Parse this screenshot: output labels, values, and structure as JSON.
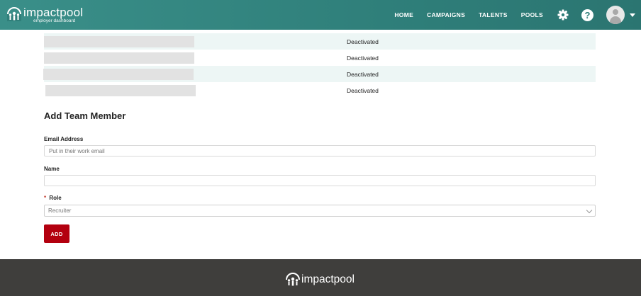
{
  "header": {
    "brand_name": "impactpool",
    "brand_sub": "employer dashboard",
    "nav": [
      {
        "label": "HOME"
      },
      {
        "label": "CAMPAIGNS"
      },
      {
        "label": "TALENTS"
      },
      {
        "label": "POOLS"
      }
    ],
    "icons": [
      "gear-icon",
      "help-icon",
      "avatar",
      "caret-down-icon"
    ],
    "help_glyph": "?"
  },
  "team": {
    "rows": [
      {
        "status": "Deactivated"
      },
      {
        "status": "Deactivated"
      },
      {
        "status": "Deactivated"
      },
      {
        "status": "Deactivated"
      }
    ]
  },
  "form": {
    "title": "Add Team Member",
    "email": {
      "label": "Email Address",
      "placeholder": "Put in their work email",
      "value": ""
    },
    "name": {
      "label": "Name",
      "value": ""
    },
    "role": {
      "required_mark": "*",
      "label": "Role",
      "selected": "Recruiter"
    },
    "submit_label": "ADD"
  },
  "footer": {
    "brand_name": "impactpool"
  },
  "colors": {
    "header_bg": "#2f7f7a",
    "row_alt_bg": "#edf6f5",
    "button_bg": "#b3000f",
    "footer_bg": "#3f3e3c"
  }
}
